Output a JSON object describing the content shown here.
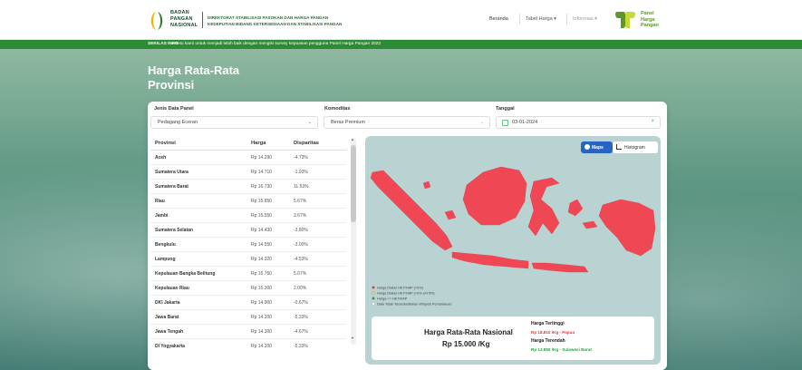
{
  "header": {
    "logo_lines": [
      "BADAN",
      "PANGAN",
      "NASIONAL"
    ],
    "org_line1": "DIREKTORAT STABILISASI PASOKAN DAN HARGA PANGAN",
    "org_line2": "KEDEPUTIAN BIDANG KETERSEDIAAN DAN STABILISASI PANGAN",
    "nav": {
      "home": "Beranda",
      "tabel": "Tabel Harga ▾",
      "info": "Informasi ▾"
    },
    "brand_lines": [
      "Panel",
      "Harga",
      "Pangan"
    ]
  },
  "ticker": {
    "label": "SEKILAS INFO",
    "text": "Bantu kami untuk menjadi lebih baik dengan mengisi survey kepuasan pengguna Panel Harga Pangan 2022"
  },
  "page_title": "Harga Rata-Rata Provinsi",
  "filters": {
    "jenis_label": "Jenis Data Panel",
    "jenis_value": "Pedagang Eceran",
    "komoditas_label": "Komoditas",
    "komoditas_value": "Beras Premium",
    "tanggal_label": "Tanggal",
    "tanggal_value": "03-01-2024"
  },
  "table": {
    "headers": [
      "Provinsi",
      "Harga",
      "Disparitas"
    ],
    "rows": [
      [
        "Aceh",
        "Rp 14.290",
        "-4.73%"
      ],
      [
        "Sumatera Utara",
        "Rp 14.710",
        "-1.93%"
      ],
      [
        "Sumatera Barat",
        "Rp 16.730",
        "11.53%"
      ],
      [
        "Riau",
        "Rp 15.850",
        "5.67%"
      ],
      [
        "Jambi",
        "Rp 15.550",
        "3.67%"
      ],
      [
        "Sumatera Selatan",
        "Rp 14.430",
        "-3.80%"
      ],
      [
        "Bengkulu",
        "Rp 14.550",
        "-3.00%"
      ],
      [
        "Lampung",
        "Rp 14.320",
        "-4.53%"
      ],
      [
        "Kepulauan Bangka Belitung",
        "Rp 15.760",
        "5.07%"
      ],
      [
        "Kepulauan Riau",
        "Rp 15.300",
        "2.00%"
      ],
      [
        "DKI Jakarta",
        "Rp 14.900",
        "-0.67%"
      ],
      [
        "Jawa Barat",
        "Rp 14.200",
        "-5.33%"
      ],
      [
        "Jawa Tengah",
        "Rp 14.300",
        "-4.67%"
      ],
      [
        "DI Yogyakarta",
        "Rp 14.200",
        "-5.33%"
      ]
    ]
  },
  "map": {
    "btn_peta": "Maps",
    "btn_hist": "Histogram",
    "legend": [
      {
        "label": "Harga Diatas HET/HAP (>5%)",
        "color": "#e53935"
      },
      {
        "label": "Harga Diatas HET/HAP (>0% s/d 5%)",
        "color": "#f4d03f"
      },
      {
        "label": "Harga <= HET/HAP",
        "color": "#2e9d46"
      },
      {
        "label": "Data Tidak Tersedia/Bukan Wilayah Pemantauan",
        "color": "#ffffff"
      }
    ],
    "fill_color": "#f04755"
  },
  "summary": {
    "nat_title": "Harga Rata-Rata Nasional",
    "nat_value": "Rp 15.000 /Kg",
    "hi_title": "Harga Tertinggi",
    "hi_value": "Rp 18.810 /Kg - Papua",
    "lo_title": "Harga Terendah",
    "lo_value": "Rp 13.850 /Kg - Sulawesi Barat"
  }
}
